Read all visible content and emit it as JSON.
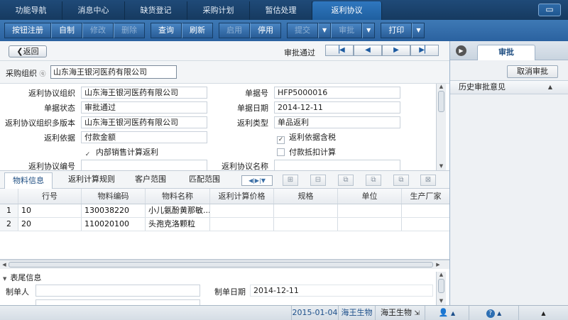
{
  "top_tabs": [
    "功能导航",
    "消息中心",
    "缺货登记",
    "采购计划",
    "暂估处理",
    "返利协议"
  ],
  "active_top_tab": "返利协议",
  "window_button": "▭",
  "toolbar": {
    "group1": [
      "按钮注册",
      "自制",
      "修改",
      "删除"
    ],
    "group2": [
      "查询",
      "刷新"
    ],
    "group3": [
      "启用",
      "停用"
    ],
    "submit": "提交",
    "approve": "审批",
    "print": "打印"
  },
  "nav": {
    "back": "返回",
    "status": "审批通过",
    "pager": [
      "first",
      "prev",
      "next",
      "last"
    ]
  },
  "purchase_org": {
    "label": "采购组织",
    "value": "山东海王银河医药有限公司"
  },
  "form": {
    "rebate_org_label": "返利协议组织",
    "rebate_org_value": "山东海王银河医药有限公司",
    "doc_no_label": "单据号",
    "doc_no_value": "HFP5000016",
    "doc_status_label": "单据状态",
    "doc_status_value": "审批通过",
    "doc_date_label": "单据日期",
    "doc_date_value": "2014-12-11",
    "multi_ver_label": "返利协议组织多版本",
    "multi_ver_value": "山东海王银河医药有限公司",
    "rebate_type_label": "返利类型",
    "rebate_type_value": "单品返利",
    "rebate_basis_label": "返利依据",
    "rebate_basis_value": "付款金额",
    "basis_tax_label": "返利依据含税",
    "internal_calc_label": "内部销售计算返利",
    "payment_deduct_label": "付款抵扣计算",
    "agreement_no_label": "返利协议编号",
    "agreement_name_label": "返利协议名称"
  },
  "detail_tabs": [
    "物料信息",
    "返利计算规则",
    "客户范围",
    "匹配范围"
  ],
  "grid": {
    "columns": [
      "行号",
      "物料编码",
      "物料名称",
      "返利计算价格",
      "规格",
      "单位",
      "生产厂家"
    ],
    "rows": [
      {
        "idx": "1",
        "line": "10",
        "code": "130038220",
        "name": "小儿氨酚黄那敏..."
      },
      {
        "idx": "2",
        "line": "20",
        "code": "110020100",
        "name": "头孢克洛颗粒"
      }
    ]
  },
  "footer": {
    "section": "表尾信息",
    "creator_label": "制单人",
    "create_date_label": "制单日期",
    "create_date_value": "2014-12-11"
  },
  "right_panel": {
    "tab": "审批",
    "cancel_approve": "取消审批",
    "history": "历史审批意见"
  },
  "statusbar": {
    "date": "2015-01-04",
    "company": "海王生物",
    "user": "海王生物"
  }
}
